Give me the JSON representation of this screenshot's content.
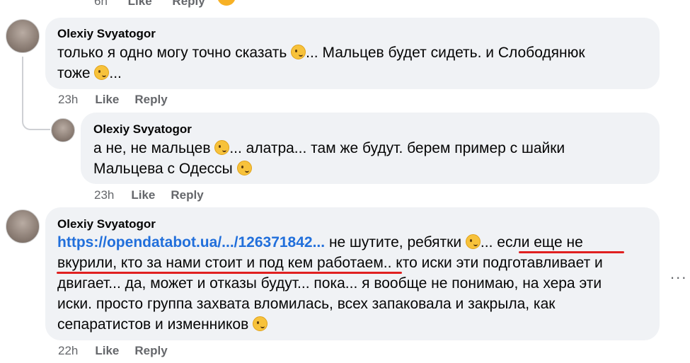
{
  "top_fragment": {
    "time": "6h",
    "like": "Like",
    "reply": "Reply"
  },
  "comments": [
    {
      "author": "Olexiy Svyatogor",
      "lines": [
        {
          "segments": [
            {
              "t": "только я одно могу точно сказать "
            },
            {
              "emoji": "wink"
            },
            {
              "t": "... Мальцев будет сидеть. и Слободянюк"
            }
          ]
        },
        {
          "segments": [
            {
              "t": "тоже "
            },
            {
              "emoji": "wink"
            },
            {
              "t": "..."
            }
          ]
        }
      ],
      "time": "23h",
      "like": "Like",
      "reply": "Reply"
    },
    {
      "author": "Olexiy Svyatogor",
      "lines": [
        {
          "segments": [
            {
              "t": "а не, не мальцев "
            },
            {
              "emoji": "wink"
            },
            {
              "t": "... алатра... там же будут. берем пример с шайки"
            }
          ]
        },
        {
          "segments": [
            {
              "t": "Мальцева с Одессы "
            },
            {
              "emoji": "wink"
            }
          ]
        }
      ],
      "time": "23h",
      "like": "Like",
      "reply": "Reply"
    },
    {
      "author": "Olexiy Svyatogor",
      "lines": [
        {
          "segments": [
            {
              "t": "https://opendatabot.ua/.../126371842...",
              "link": true
            },
            {
              "t": " не шутите, ребятки "
            },
            {
              "emoji": "wink"
            },
            {
              "t": "... если еще не"
            }
          ]
        },
        {
          "segments": [
            {
              "t": "вкурили, кто за нами стоит и под кем работаем.. кто иски эти подготавливает и"
            }
          ]
        },
        {
          "segments": [
            {
              "t": "двигает... да, может и отказы будут... пока... я вообще не понимаю, на хера эти"
            }
          ]
        },
        {
          "segments": [
            {
              "t": "иски. просто группа захвата вломилась, всех запаковала и закрыла, как"
            }
          ]
        },
        {
          "segments": [
            {
              "t": "сепаратистов и изменников "
            },
            {
              "emoji": "wink"
            }
          ]
        }
      ],
      "time": "22h",
      "like": "Like",
      "reply": "Reply"
    }
  ],
  "more_label": "...",
  "colors": {
    "bubble": "#f0f2f5",
    "link": "#216fdb",
    "meta": "#65676b",
    "underline": "#e02020"
  },
  "icons": {
    "emoji": "winking-face-icon",
    "more": "more-options-icon"
  }
}
